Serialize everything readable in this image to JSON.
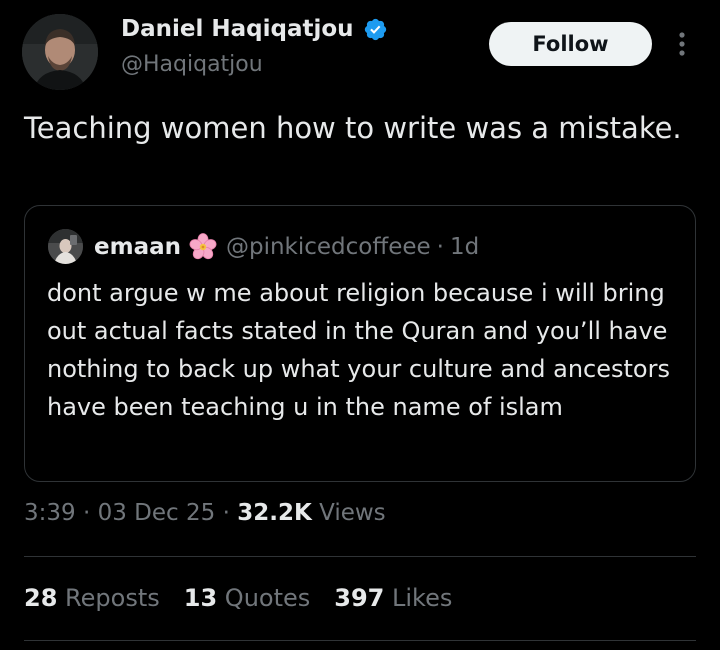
{
  "author": {
    "name": "Daniel Haqiqatjou",
    "handle": "@Haqiqatjou",
    "verified": true,
    "verified_color": "#1d9bf0"
  },
  "follow_button": {
    "label": "Follow"
  },
  "more_icon": "more-vertical-icon",
  "tweet": {
    "text": "Teaching women how to write was a mistake."
  },
  "quoted_tweet": {
    "name": "emaan",
    "emoji": "cherry-blossom-icon",
    "handle": "@pinkicedcoffeee",
    "separator": "·",
    "time": "1d",
    "text": "dont argue w me about religion because i will bring out actual facts stated in the Quran and you’ll have nothing to back up what your culture and ancestors have been teaching u in the name of islam"
  },
  "meta": {
    "time": "3:39",
    "sep1": "·",
    "date": "03 Dec 25",
    "sep2": "·",
    "views_count": "32.2K",
    "views_label": "Views"
  },
  "stats": {
    "reposts_count": "28",
    "reposts_label": "Reposts",
    "quotes_count": "13",
    "quotes_label": "Quotes",
    "likes_count": "397",
    "likes_label": "Likes"
  },
  "colors": {
    "background": "#000000",
    "primary_text": "#e7e9ea",
    "secondary_text": "#71767b",
    "border": "#2f3336",
    "follow_bg": "#eff3f4"
  }
}
